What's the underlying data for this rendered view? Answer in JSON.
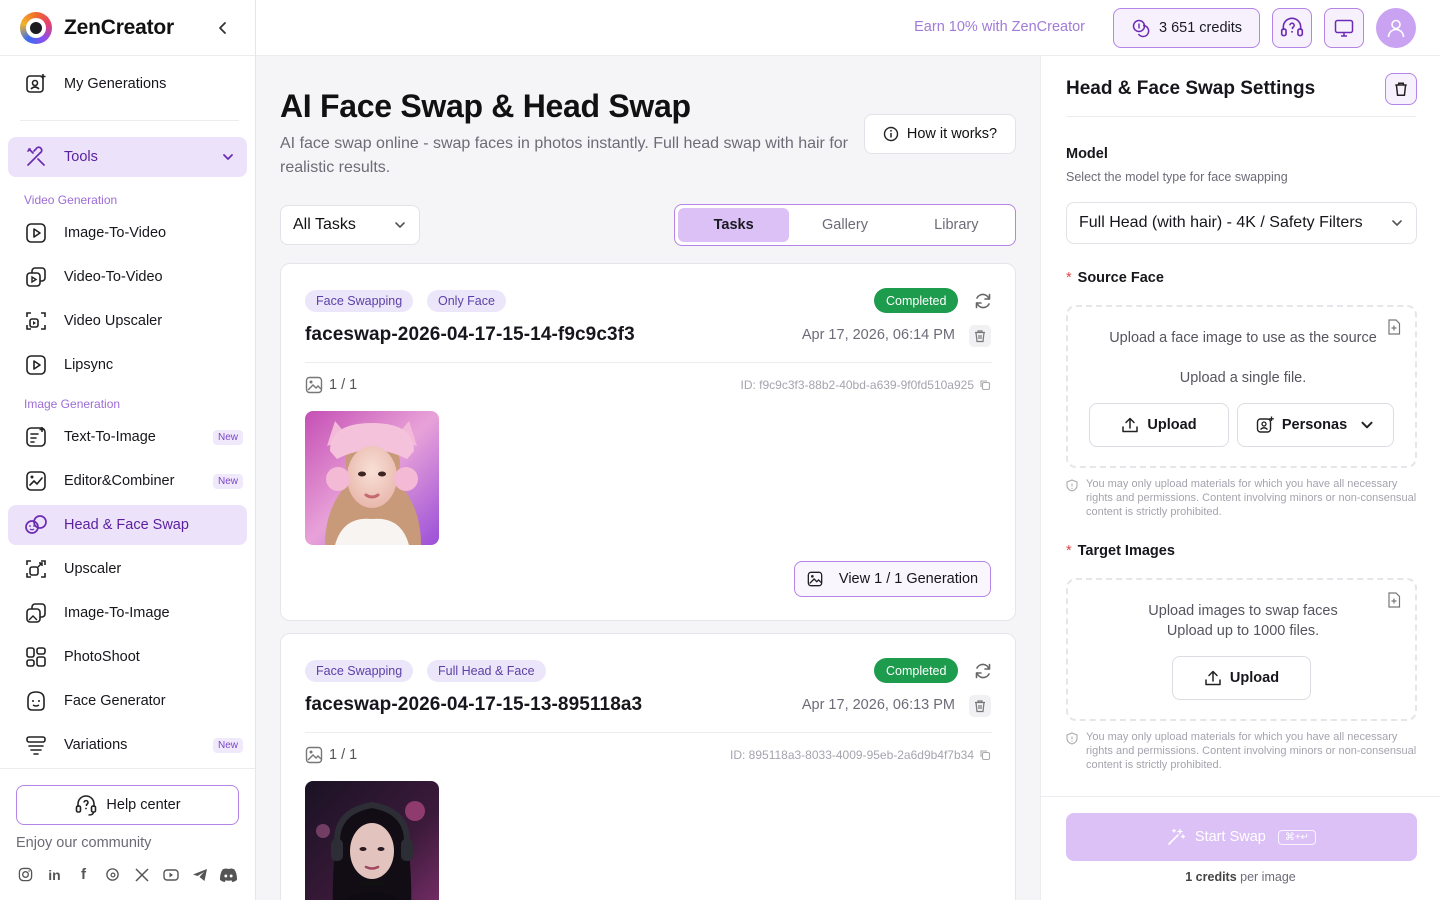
{
  "brand": {
    "name": "ZenCreator"
  },
  "sidebar": {
    "my_generations": "My Generations",
    "tools_label": "Tools",
    "video_group": "Video Generation",
    "image_group": "Image Generation",
    "new_badge": "New",
    "video_items": [
      "Image-To-Video",
      "Video-To-Video",
      "Video Upscaler",
      "Lipsync"
    ],
    "image_items": [
      "Text-To-Image",
      "Editor&Combiner",
      "Head & Face Swap",
      "Upscaler",
      "Image-To-Image",
      "PhotoShoot",
      "Face Generator",
      "Variations"
    ],
    "help_center": "Help center",
    "community": "Enjoy our community",
    "socials": [
      "instagram-icon",
      "linkedin-icon",
      "facebook-icon",
      "threads-icon",
      "x-icon",
      "youtube-icon",
      "telegram-icon",
      "discord-icon"
    ]
  },
  "topbar": {
    "earn": "Earn 10% with ZenCreator",
    "credits": "3 651 credits"
  },
  "main": {
    "title": "AI Face Swap & Head Swap",
    "subtitle": "AI face swap online - swap faces in photos instantly. Full head swap with hair for realistic results.",
    "how_it_works": "How it works?",
    "filter": "All Tasks",
    "tabs": [
      "Tasks",
      "Gallery",
      "Library"
    ],
    "cards": [
      {
        "tags": [
          "Face Swapping",
          "Only Face"
        ],
        "status": "Completed",
        "title": "faceswap-2026-04-17-15-14-f9c9c3f3",
        "date": "Apr 17, 2026, 06:14 PM",
        "count": "1 / 1",
        "id": "ID: f9c9c3f3-88b2-40bd-a639-9f0fd510a925",
        "view": "View 1 / 1 Generation"
      },
      {
        "tags": [
          "Face Swapping",
          "Full Head & Face"
        ],
        "status": "Completed",
        "title": "faceswap-2026-04-17-15-13-895118a3",
        "date": "Apr 17, 2026, 06:13 PM",
        "count": "1 / 1",
        "id": "ID: 895118a3-8033-4009-95eb-2a6d9b4f7b34"
      }
    ]
  },
  "panel": {
    "title": "Head & Face Swap Settings",
    "model_label": "Model",
    "model_desc": "Select the model type for face swapping",
    "model_value": "Full Head (with hair) - 4K /  Safety Filters",
    "source_label": "Source Face",
    "source_line1": "Upload a face image to use as the source",
    "source_line2": "Upload a single file.",
    "upload": "Upload",
    "personas": "Personas",
    "notice": "You may only upload materials for which you have all necessary rights and permissions. Content involving minors or non-consensual content is strictly prohibited.",
    "target_label": "Target Images",
    "target_line1": "Upload images to swap faces",
    "target_line2": "Upload up to 1000 files.",
    "start": "Start Swap",
    "shortcut": "⌘+↵",
    "credits_bold": "1 credits",
    "credits_rest": " per image"
  },
  "colors": {
    "accent": "#b484e6",
    "accent_soft": "#ece3fb",
    "active_text": "#5b1f9e",
    "success": "#1d9c4d"
  }
}
